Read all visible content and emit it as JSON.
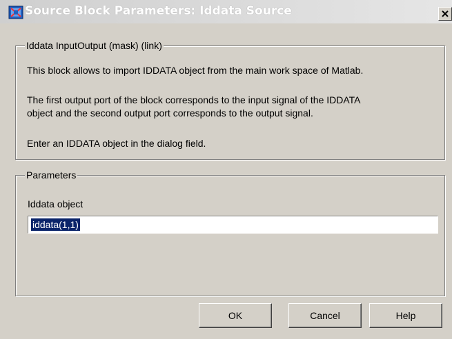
{
  "window": {
    "title": "Source Block Parameters: Iddata Source",
    "close_label": "X"
  },
  "description_group": {
    "legend": "Iddata InputOutput (mask) (link)",
    "lines": [
      "This block allows to import IDDATA object from the main work space of Matlab.",
      "The first output port of the block corresponds to the input signal of the IDDATA",
      "object and the second output port corresponds to the output signal.",
      "Enter an IDDATA object in the dialog field."
    ]
  },
  "parameters_group": {
    "legend": "Parameters",
    "field_label": "Iddata object",
    "field_value": "iddata(1,1)"
  },
  "buttons": {
    "ok": "OK",
    "cancel": "Cancel",
    "help": "Help"
  }
}
